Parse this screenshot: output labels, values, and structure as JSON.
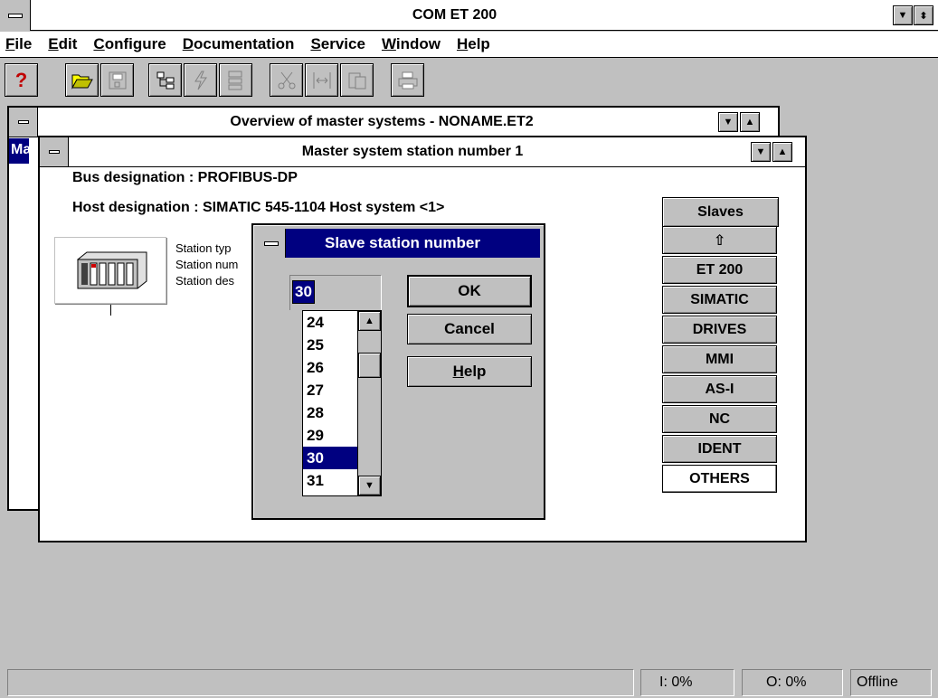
{
  "app": {
    "title": "COM ET 200"
  },
  "menu": {
    "items": [
      {
        "accel": "F",
        "rest": "ile"
      },
      {
        "accel": "E",
        "rest": "dit"
      },
      {
        "accel": "C",
        "rest": "onfigure"
      },
      {
        "accel": "D",
        "rest": "ocumentation"
      },
      {
        "accel": "S",
        "rest": "ervice"
      },
      {
        "accel": "W",
        "rest": "indow"
      },
      {
        "accel": "H",
        "rest": "elp"
      }
    ]
  },
  "toolbar": {
    "icons": [
      "help-icon",
      "open-folder-icon",
      "save-icon",
      "network-icon",
      "transfer-icon",
      "tree-icon",
      "cut-icon",
      "split-icon",
      "copy-icon",
      "print-icon"
    ],
    "help_glyph": "?"
  },
  "overview_window": {
    "title": "Overview of master systems - NONAME.ET2",
    "left_label": "Ma"
  },
  "master_window": {
    "title": "Master system station number  1",
    "bus_designation": "Bus designation  : PROFIBUS-DP",
    "host_designation": "Host designation : SIMATIC 545-1104  Host system <1>",
    "station_info": [
      "Station typ",
      "Station num",
      "Station des"
    ]
  },
  "slaves_panel": {
    "header": "Slaves",
    "up_glyph": "⇧",
    "buttons": [
      "ET 200",
      "SIMATIC",
      "DRIVES",
      "MMI",
      "AS-I",
      "NC",
      "IDENT",
      "OTHERS"
    ]
  },
  "dialog": {
    "title": "Slave station number",
    "input_value": "30",
    "list_items": [
      "24",
      "25",
      "26",
      "27",
      "28",
      "29",
      "30",
      "31"
    ],
    "selected_item": "30",
    "ok_label": "OK",
    "cancel_label": "Cancel",
    "help_accel": "H",
    "help_rest": "elp"
  },
  "statusbar": {
    "input": "I: 0%",
    "output": "O: 0%",
    "mode": "Offline"
  },
  "colors": {
    "face": "#c0c0c0",
    "selection": "#000080",
    "title_active": "#000080",
    "window_bg": "#ffffff"
  }
}
